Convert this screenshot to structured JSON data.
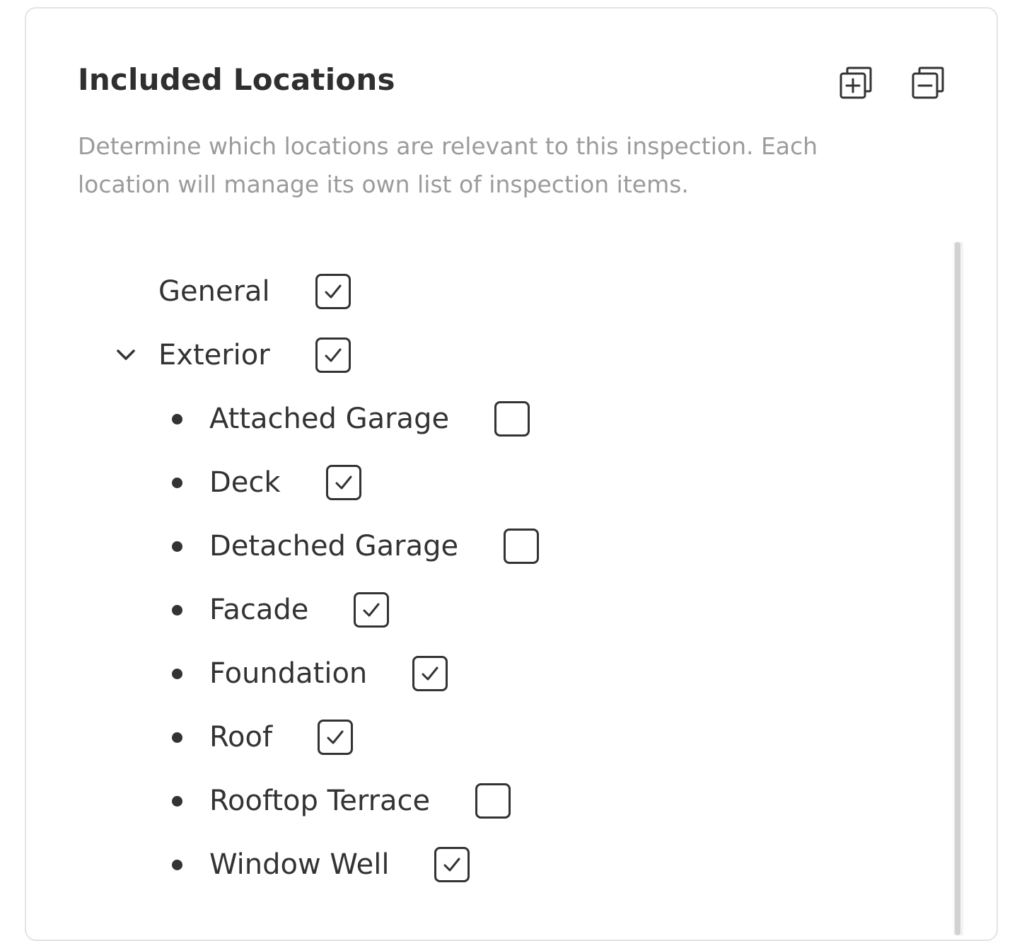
{
  "panel": {
    "title": "Included Locations",
    "description": "Determine which locations are relevant to this inspection. Each location will manage its own list of inspection items.",
    "expand_all_icon": "expand-all-icon",
    "collapse_all_icon": "collapse-all-icon"
  },
  "tree": {
    "general": {
      "label": "General",
      "checked": true
    },
    "exterior": {
      "label": "Exterior",
      "checked": true,
      "expanded": true,
      "children": [
        {
          "label": "Attached Garage",
          "checked": false
        },
        {
          "label": "Deck",
          "checked": true
        },
        {
          "label": "Detached Garage",
          "checked": false
        },
        {
          "label": "Facade",
          "checked": true
        },
        {
          "label": "Foundation",
          "checked": true
        },
        {
          "label": "Roof",
          "checked": true
        },
        {
          "label": "Rooftop Terrace",
          "checked": false
        },
        {
          "label": "Window Well",
          "checked": true
        }
      ]
    }
  },
  "colors": {
    "text": "#333333",
    "muted": "#9b9b9b",
    "border": "#e2e4e7"
  }
}
